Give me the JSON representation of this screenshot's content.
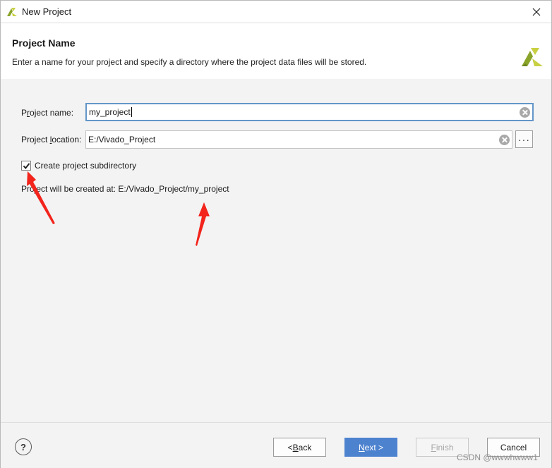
{
  "window": {
    "title": "New Project",
    "close_icon": "close-icon",
    "logo_icon": "vivado-logo-icon"
  },
  "header": {
    "title": "Project Name",
    "description": "Enter a name for your project and specify a directory where the project data files will be stored."
  },
  "form": {
    "project_name": {
      "label_pre": "P",
      "label_mnemonic": "r",
      "label_post": "oject name:",
      "value": "my_project"
    },
    "project_location": {
      "label_pre": "Project ",
      "label_mnemonic": "l",
      "label_post": "ocation:",
      "value": "E:/Vivado_Project",
      "browse_label": "···"
    },
    "create_subdirectory": {
      "label": "Create project subdirectory",
      "checked": true
    },
    "created_at": "Project will be created at: E:/Vivado_Project/my_project"
  },
  "footer": {
    "help_label": "?",
    "back": {
      "pre": "< ",
      "mnemonic": "B",
      "post": "ack"
    },
    "next": {
      "pre": "",
      "mnemonic": "N",
      "post": "ext >"
    },
    "finish": {
      "pre": "",
      "mnemonic": "F",
      "post": "inish"
    },
    "cancel": {
      "label": "Cancel"
    }
  },
  "watermark": "CSDN @wwwhwww1",
  "colors": {
    "accent": "#4d82cf",
    "focus_border": "#6496c8",
    "annotation_arrow": "#f2241c",
    "logo_green": "#8aa42a",
    "logo_yellow": "#c8d042"
  }
}
